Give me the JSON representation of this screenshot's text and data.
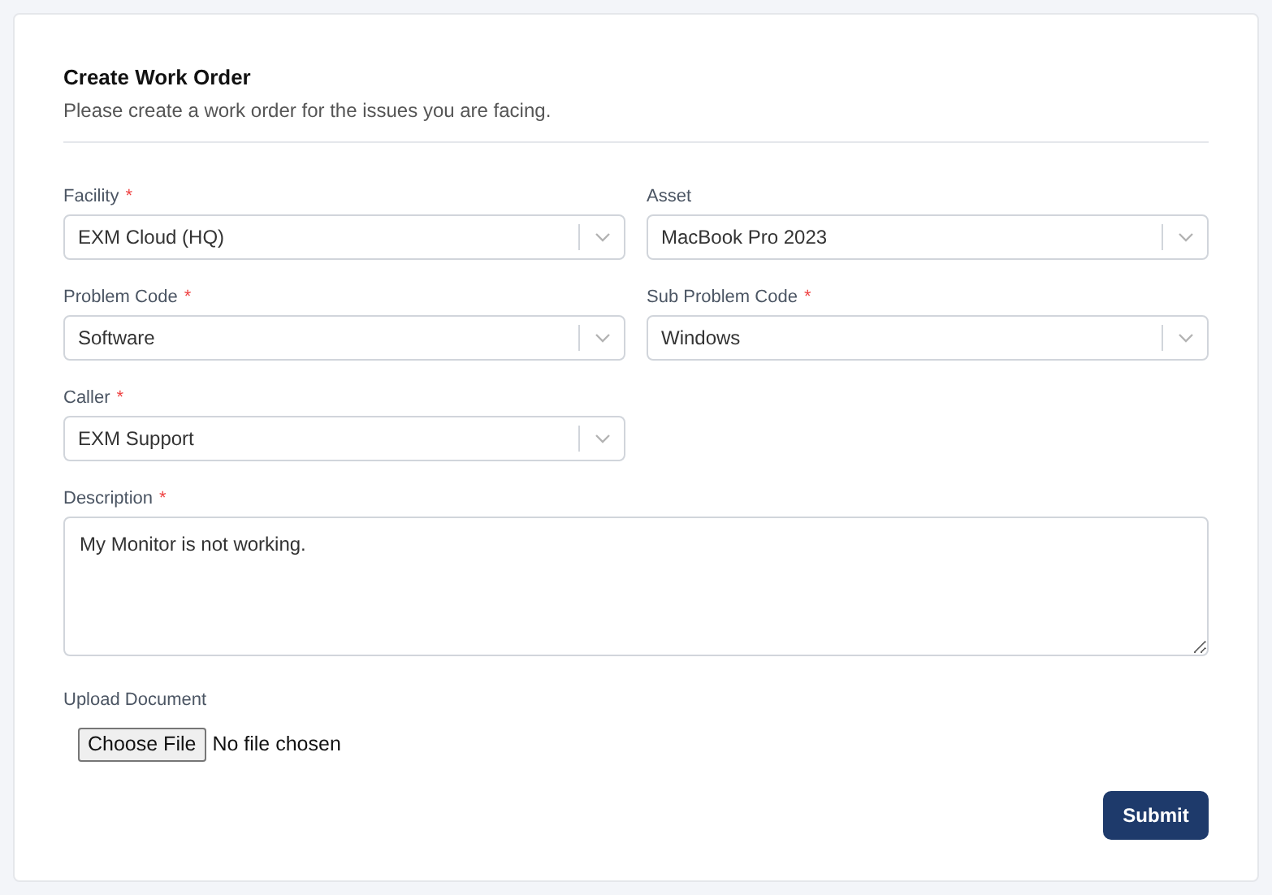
{
  "form": {
    "title": "Create Work Order",
    "subtitle": "Please create a work order for the issues you are facing.",
    "required_mark": "*",
    "selects": [
      {
        "label": "Facility",
        "required": true,
        "value": "EXM Cloud (HQ)"
      },
      {
        "label": "Asset",
        "required": false,
        "value": "MacBook Pro 2023"
      },
      {
        "label": "Problem Code",
        "required": true,
        "value": "Software"
      },
      {
        "label": "Sub Problem Code",
        "required": true,
        "value": "Windows"
      },
      {
        "label": "Caller",
        "required": true,
        "value": "EXM Support"
      }
    ],
    "description": {
      "label": "Description",
      "required": true,
      "value": "My Monitor is not working."
    },
    "upload": {
      "label": "Upload Document",
      "button": "Choose File",
      "status": "No file chosen"
    },
    "submit": "Submit"
  }
}
